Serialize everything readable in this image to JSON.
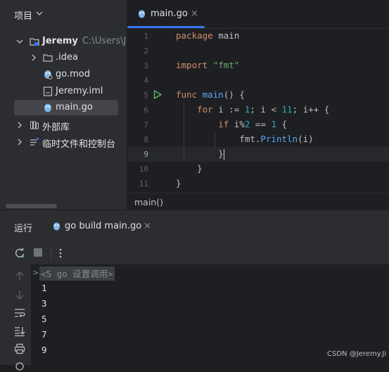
{
  "project": {
    "title": "项目",
    "root_name": "Jeremy",
    "root_path": "C:\\Users\\Jer",
    "items": [
      {
        "label": ".idea"
      },
      {
        "label": "go.mod"
      },
      {
        "label": "Jeremy.iml"
      },
      {
        "label": "main.go"
      },
      {
        "label": "外部库"
      },
      {
        "label": "临时文件和控制台"
      }
    ]
  },
  "editor": {
    "tab_label": "main.go",
    "tab_close": "×",
    "line_numbers": [
      "1",
      "2",
      "3",
      "4",
      "5",
      "6",
      "7",
      "8",
      "9",
      "10",
      "11"
    ],
    "breadcrumb": "main()"
  },
  "run": {
    "title": "运行",
    "tab_label": "go build main.go",
    "tab_close": "×",
    "command": "<5 go 设置调用>",
    "output": [
      "1",
      "3",
      "5",
      "7",
      "9"
    ]
  },
  "watermark": "CSDN @Jeremy.Ji",
  "colors": {
    "accent": "#3574f0",
    "run_green": "#5fb865",
    "keyword": "#cf8e6d",
    "function": "#56a8f5",
    "string": "#6aab73",
    "number": "#2aacb8"
  }
}
